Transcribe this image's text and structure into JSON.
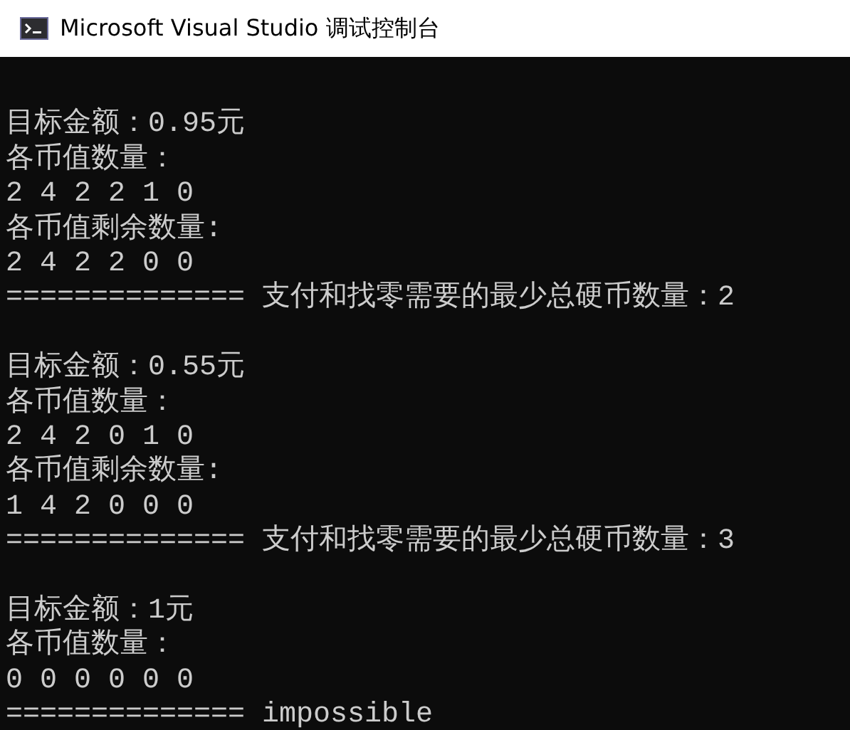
{
  "window": {
    "title": "Microsoft Visual Studio 调试控制台"
  },
  "console": {
    "blocks": [
      {
        "lines": [
          "目标金额：0.95元",
          "各币值数量：",
          "2 4 2 2 1 0",
          "各币值剩余数量:",
          "2 4 2 2 0 0",
          "============== 支付和找零需要的最少总硬币数量：2"
        ]
      },
      {
        "lines": [
          "目标金额：0.55元",
          "各币值数量：",
          "2 4 2 0 1 0",
          "各币值剩余数量:",
          "1 4 2 0 0 0",
          "============== 支付和找零需要的最少总硬币数量：3"
        ]
      },
      {
        "lines": [
          "目标金额：1元",
          "各币值数量：",
          "0 0 0 0 0 0",
          "============== impossible"
        ]
      }
    ]
  }
}
